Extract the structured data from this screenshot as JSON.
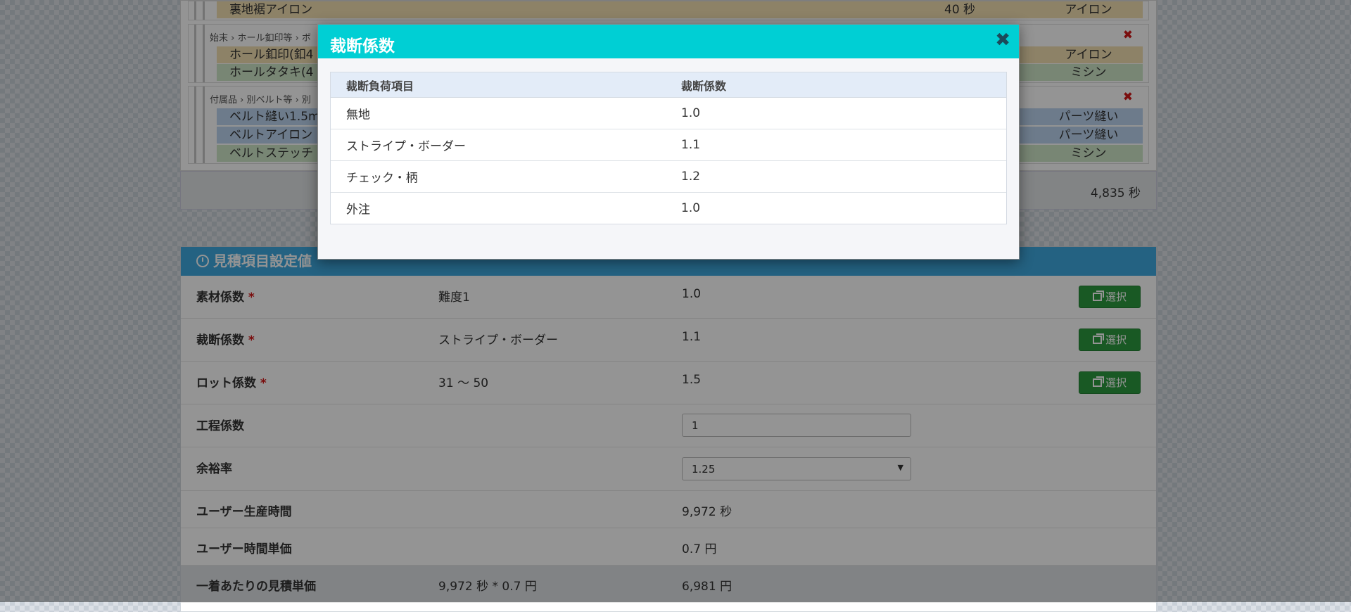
{
  "process_list": {
    "top_step": {
      "name": "裏地裾アイロン",
      "time": "40 秒",
      "method": "アイロン"
    },
    "groups": [
      {
        "breadcrumb": "始末 › ホール釦印等 › ボ",
        "steps": [
          {
            "name": "ホール釦印(釦4",
            "method": "アイロン",
            "kind": "ironing"
          },
          {
            "name": "ホールタタキ(4",
            "method": "ミシン",
            "kind": "sewing"
          }
        ]
      },
      {
        "breadcrumb": "付属品 › 別ベルト等 › 別",
        "steps": [
          {
            "name": "ベルト縫い1.5m",
            "method": "パーツ縫い",
            "kind": "parts"
          },
          {
            "name": "ベルトアイロン",
            "method": "パーツ縫い",
            "kind": "parts"
          },
          {
            "name": "ベルトステッチ",
            "method": "ミシン",
            "kind": "sewing"
          }
        ]
      }
    ],
    "delete_icon": "close-x-icon",
    "total_time": "4,835 秒"
  },
  "settings": {
    "title": "見積項目設定値",
    "select_label": "選択",
    "rows": {
      "material": {
        "label": "素材係数",
        "value": "難度1",
        "coef": "1.0"
      },
      "cutting": {
        "label": "裁断係数",
        "value": "ストライプ・ボーダー",
        "coef": "1.1"
      },
      "lot": {
        "label": "ロット係数",
        "value": "31 ～ 50",
        "coef": "1.5"
      },
      "process": {
        "label": "工程係数",
        "input_value": "1"
      },
      "margin": {
        "label": "余裕率",
        "selected": "1.25"
      },
      "user_time": {
        "label": "ユーザー生産時間",
        "value": "9,972 秒"
      },
      "user_rate": {
        "label": "ユーザー時間単価",
        "value": "0.7 円"
      },
      "estimate": {
        "label": "一着あたりの見積単価",
        "formula": "9,972 秒 * 0.7 円",
        "value": "6,981 円"
      }
    },
    "required_mark": "*"
  },
  "modal": {
    "title": "裁断係数",
    "close_glyph": "✖",
    "columns": [
      "裁断負荷項目",
      "裁断係数"
    ],
    "rows": [
      {
        "item": "無地",
        "coef": "1.0"
      },
      {
        "item": "ストライプ・ボーダー",
        "coef": "1.1"
      },
      {
        "item": "チェック・柄",
        "coef": "1.2"
      },
      {
        "item": "外注",
        "coef": "1.0"
      }
    ]
  },
  "colors": {
    "modal_header": "#00cfd4",
    "settings_header": "#3fa9e1",
    "select_button": "#2c9a3f",
    "required": "#d21919"
  }
}
